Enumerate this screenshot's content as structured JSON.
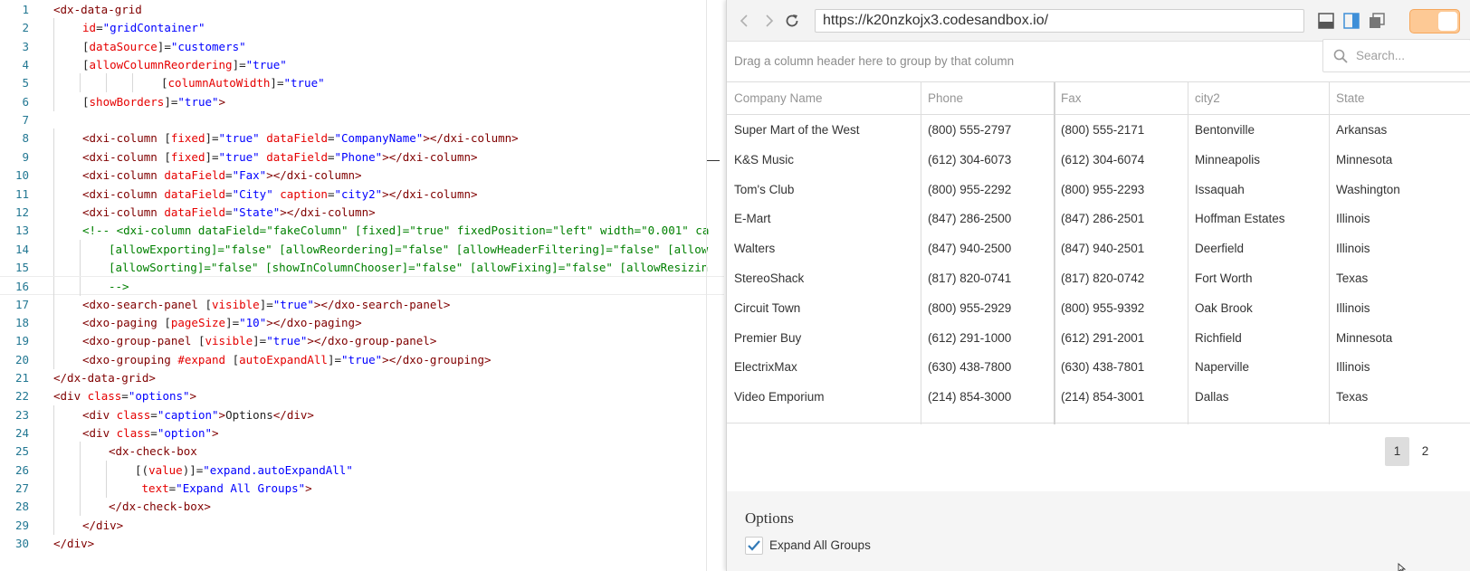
{
  "editor": {
    "lines": [
      {
        "n": "1",
        "indent": 0,
        "tokens": [
          [
            "tag",
            "<dx-data-grid"
          ]
        ]
      },
      {
        "n": "2",
        "indent": 1,
        "tokens": [
          [
            "attr",
            "id"
          ],
          [
            "txt",
            "="
          ],
          [
            "str",
            "\"gridContainer\""
          ]
        ]
      },
      {
        "n": "3",
        "indent": 1,
        "tokens": [
          [
            "txt",
            "["
          ],
          [
            "attr",
            "dataSource"
          ],
          [
            "txt",
            "]="
          ],
          [
            "str",
            "\"customers\""
          ]
        ]
      },
      {
        "n": "4",
        "indent": 1,
        "tokens": [
          [
            "txt",
            "["
          ],
          [
            "attr",
            "allowColumnReordering"
          ],
          [
            "txt",
            "]="
          ],
          [
            "str",
            "\"true\""
          ]
        ]
      },
      {
        "n": "5",
        "indent": 4,
        "tokens": [
          [
            "txt",
            "["
          ],
          [
            "attr",
            "columnAutoWidth"
          ],
          [
            "txt",
            "]="
          ],
          [
            "str",
            "\"true\""
          ]
        ]
      },
      {
        "n": "6",
        "indent": 1,
        "tokens": [
          [
            "txt",
            "["
          ],
          [
            "attr",
            "showBorders"
          ],
          [
            "txt",
            "]="
          ],
          [
            "str",
            "\"true\""
          ],
          [
            "tag",
            ">"
          ]
        ]
      },
      {
        "n": "7",
        "indent": 0,
        "tokens": []
      },
      {
        "n": "8",
        "indent": 1,
        "tokens": [
          [
            "tag",
            "<dxi-column "
          ],
          [
            "txt",
            "["
          ],
          [
            "attr",
            "fixed"
          ],
          [
            "txt",
            "]="
          ],
          [
            "str",
            "\"true\""
          ],
          [
            "txt",
            " "
          ],
          [
            "attr",
            "dataField"
          ],
          [
            "txt",
            "="
          ],
          [
            "str",
            "\"CompanyName\""
          ],
          [
            "tag",
            "></dxi-column>"
          ]
        ]
      },
      {
        "n": "9",
        "indent": 1,
        "tokens": [
          [
            "tag",
            "<dxi-column "
          ],
          [
            "txt",
            "["
          ],
          [
            "attr",
            "fixed"
          ],
          [
            "txt",
            "]="
          ],
          [
            "str",
            "\"true\""
          ],
          [
            "txt",
            " "
          ],
          [
            "attr",
            "dataField"
          ],
          [
            "txt",
            "="
          ],
          [
            "str",
            "\"Phone\""
          ],
          [
            "tag",
            "></dxi-column>"
          ]
        ]
      },
      {
        "n": "10",
        "indent": 1,
        "tokens": [
          [
            "tag",
            "<dxi-column "
          ],
          [
            "attr",
            "dataField"
          ],
          [
            "txt",
            "="
          ],
          [
            "str",
            "\"Fax\""
          ],
          [
            "tag",
            "></dxi-column>"
          ]
        ]
      },
      {
        "n": "11",
        "indent": 1,
        "tokens": [
          [
            "tag",
            "<dxi-column "
          ],
          [
            "attr",
            "dataField"
          ],
          [
            "txt",
            "="
          ],
          [
            "str",
            "\"City\""
          ],
          [
            "txt",
            " "
          ],
          [
            "attr",
            "caption"
          ],
          [
            "txt",
            "="
          ],
          [
            "str",
            "\"city2\""
          ],
          [
            "tag",
            "></dxi-column>"
          ]
        ]
      },
      {
        "n": "12",
        "indent": 1,
        "tokens": [
          [
            "tag",
            "<dxi-column "
          ],
          [
            "attr",
            "dataField"
          ],
          [
            "txt",
            "="
          ],
          [
            "str",
            "\"State\""
          ],
          [
            "tag",
            "></dxi-column>"
          ]
        ]
      },
      {
        "n": "13",
        "indent": 1,
        "tokens": [
          [
            "com",
            "<!-- <dxi-column dataField=\"fakeColumn\" [fixed]=\"true\" fixedPosition=\"left\" width=\"0.001\" ca"
          ]
        ]
      },
      {
        "n": "14",
        "indent": 2,
        "tokens": [
          [
            "com",
            "[allowExporting]=\"false\" [allowReordering]=\"false\" [allowHeaderFiltering]=\"false\" [allow"
          ]
        ]
      },
      {
        "n": "15",
        "indent": 2,
        "tokens": [
          [
            "com",
            "[allowSorting]=\"false\" [showInColumnChooser]=\"false\" [allowFixing]=\"false\" [allowResizin"
          ]
        ]
      },
      {
        "n": "16",
        "indent": 2,
        "current": true,
        "tokens": [
          [
            "com",
            "-->"
          ]
        ]
      },
      {
        "n": "17",
        "indent": 1,
        "tokens": [
          [
            "tag",
            "<dxo-search-panel "
          ],
          [
            "txt",
            "["
          ],
          [
            "attr",
            "visible"
          ],
          [
            "txt",
            "]="
          ],
          [
            "str",
            "\"true\""
          ],
          [
            "tag",
            "></dxo-search-panel>"
          ]
        ]
      },
      {
        "n": "18",
        "indent": 1,
        "tokens": [
          [
            "tag",
            "<dxo-paging "
          ],
          [
            "txt",
            "["
          ],
          [
            "attr",
            "pageSize"
          ],
          [
            "txt",
            "]="
          ],
          [
            "str",
            "\"10\""
          ],
          [
            "tag",
            "></dxo-paging>"
          ]
        ]
      },
      {
        "n": "19",
        "indent": 1,
        "tokens": [
          [
            "tag",
            "<dxo-group-panel "
          ],
          [
            "txt",
            "["
          ],
          [
            "attr",
            "visible"
          ],
          [
            "txt",
            "]="
          ],
          [
            "str",
            "\"true\""
          ],
          [
            "tag",
            "></dxo-group-panel>"
          ]
        ]
      },
      {
        "n": "20",
        "indent": 1,
        "tokens": [
          [
            "tag",
            "<dxo-grouping "
          ],
          [
            "attr",
            "#expand"
          ],
          [
            "txt",
            " ["
          ],
          [
            "attr",
            "autoExpandAll"
          ],
          [
            "txt",
            "]="
          ],
          [
            "str",
            "\"true\""
          ],
          [
            "tag",
            "></dxo-grouping>"
          ]
        ]
      },
      {
        "n": "21",
        "indent": 0,
        "tokens": [
          [
            "tag",
            "</dx-data-grid>"
          ]
        ]
      },
      {
        "n": "22",
        "indent": 0,
        "tokens": [
          [
            "tag",
            "<div "
          ],
          [
            "attr",
            "class"
          ],
          [
            "txt",
            "="
          ],
          [
            "str",
            "\"options\""
          ],
          [
            "tag",
            ">"
          ]
        ]
      },
      {
        "n": "23",
        "indent": 1,
        "tokens": [
          [
            "tag",
            "<div "
          ],
          [
            "attr",
            "class"
          ],
          [
            "txt",
            "="
          ],
          [
            "str",
            "\"caption\""
          ],
          [
            "tag",
            ">"
          ],
          [
            "txt",
            "Options"
          ],
          [
            "tag",
            "</div>"
          ]
        ]
      },
      {
        "n": "24",
        "indent": 1,
        "tokens": [
          [
            "tag",
            "<div "
          ],
          [
            "attr",
            "class"
          ],
          [
            "txt",
            "="
          ],
          [
            "str",
            "\"option\""
          ],
          [
            "tag",
            ">"
          ]
        ]
      },
      {
        "n": "25",
        "indent": 2,
        "tokens": [
          [
            "tag",
            "<dx-check-box"
          ]
        ]
      },
      {
        "n": "26",
        "indent": 3,
        "tokens": [
          [
            "txt",
            "[("
          ],
          [
            "attr",
            "value"
          ],
          [
            "txt",
            ")]="
          ],
          [
            "str",
            "\"expand.autoExpandAll\""
          ]
        ]
      },
      {
        "n": "27",
        "indent": 3,
        "tokens": [
          [
            "txt",
            " "
          ],
          [
            "attr",
            "text"
          ],
          [
            "txt",
            "="
          ],
          [
            "str",
            "\"Expand All Groups\""
          ],
          [
            "tag",
            ">"
          ]
        ]
      },
      {
        "n": "28",
        "indent": 2,
        "tokens": [
          [
            "tag",
            "</dx-check-box>"
          ]
        ]
      },
      {
        "n": "29",
        "indent": 1,
        "tokens": [
          [
            "tag",
            "</div>"
          ]
        ]
      },
      {
        "n": "30",
        "indent": 0,
        "tokens": [
          [
            "tag",
            "</div>"
          ]
        ]
      }
    ]
  },
  "browser": {
    "url": "https://k20nzkojx3.codesandbox.io/",
    "back_icon": "chevron-left-icon",
    "forward_icon": "chevron-right-icon",
    "reload_icon": "reload-icon",
    "accent_color": "#3e8fd8",
    "toggle_color": "#fdc995"
  },
  "grid": {
    "group_panel_hint": "Drag a column header here to group by that column",
    "search_placeholder": "Search...",
    "columns": [
      "Company Name",
      "Phone",
      "Fax",
      "city2",
      "State"
    ],
    "rows": [
      [
        "Super Mart of the West",
        "(800) 555-2797",
        "(800) 555-2171",
        "Bentonville",
        "Arkansas"
      ],
      [
        "K&S Music",
        "(612) 304-6073",
        "(612) 304-6074",
        "Minneapolis",
        "Minnesota"
      ],
      [
        "Tom's Club",
        "(800) 955-2292",
        "(800) 955-2293",
        "Issaquah",
        "Washington"
      ],
      [
        "E-Mart",
        "(847) 286-2500",
        "(847) 286-2501",
        "Hoffman Estates",
        "Illinois"
      ],
      [
        "Walters",
        "(847) 940-2500",
        "(847) 940-2501",
        "Deerfield",
        "Illinois"
      ],
      [
        "StereoShack",
        "(817) 820-0741",
        "(817) 820-0742",
        "Fort Worth",
        "Texas"
      ],
      [
        "Circuit Town",
        "(800) 955-2929",
        "(800) 955-9392",
        "Oak Brook",
        "Illinois"
      ],
      [
        "Premier Buy",
        "(612) 291-1000",
        "(612) 291-2001",
        "Richfield",
        "Minnesota"
      ],
      [
        "ElectrixMax",
        "(630) 438-7800",
        "(630) 438-7801",
        "Naperville",
        "Illinois"
      ],
      [
        "Video Emporium",
        "(214) 854-3000",
        "(214) 854-3001",
        "Dallas",
        "Texas"
      ]
    ],
    "pages": [
      "1",
      "2"
    ],
    "active_page": "1"
  },
  "options": {
    "caption": "Options",
    "checkbox_label": "Expand All Groups",
    "checkbox_checked": true,
    "check_color": "#337ab7"
  }
}
